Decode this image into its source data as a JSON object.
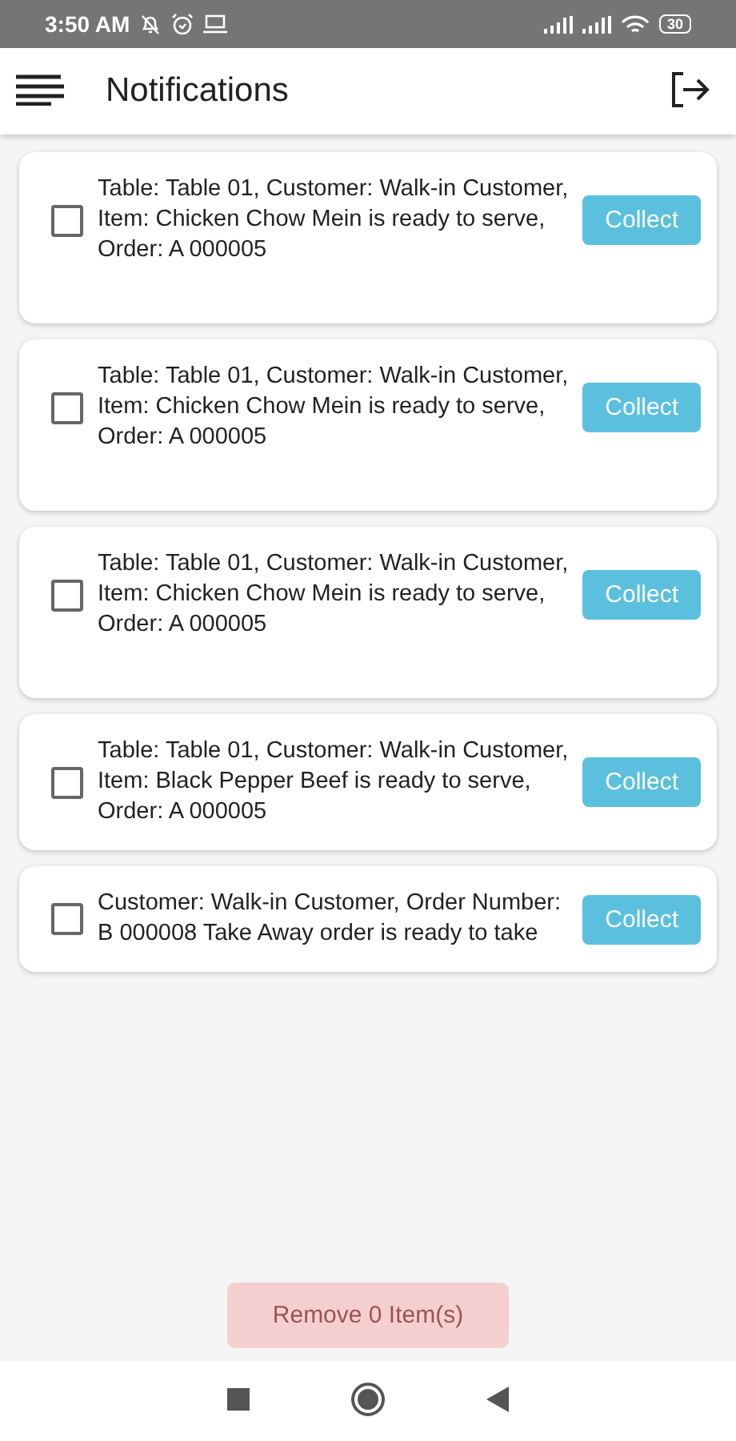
{
  "status_bar": {
    "time": "3:50 AM",
    "battery": "30"
  },
  "header": {
    "title": "Notifications"
  },
  "notifications": [
    {
      "text": "Table: Table 01, Customer: Walk-in Customer, Item: Chicken Chow Mein is ready to serve, Order: A 000005",
      "checked": false,
      "button": "Collect"
    },
    {
      "text": "Table: Table 01, Customer: Walk-in Customer, Item: Chicken Chow Mein is ready to serve, Order: A 000005",
      "checked": false,
      "button": "Collect"
    },
    {
      "text": "Table: Table 01, Customer: Walk-in Customer, Item: Chicken Chow Mein is ready to serve, Order: A 000005",
      "checked": false,
      "button": "Collect"
    },
    {
      "text": "Table: Table 01, Customer: Walk-in Customer, Item: Black Pepper Beef is ready to serve, Order: A 000005",
      "checked": false,
      "button": "Collect"
    },
    {
      "text": "Customer: Walk-in Customer, Order Number: B 000008 Take Away order is ready to take",
      "checked": false,
      "button": "Collect"
    }
  ],
  "remove_button": {
    "label": "Remove 0 Item(s)",
    "disabled": true
  }
}
